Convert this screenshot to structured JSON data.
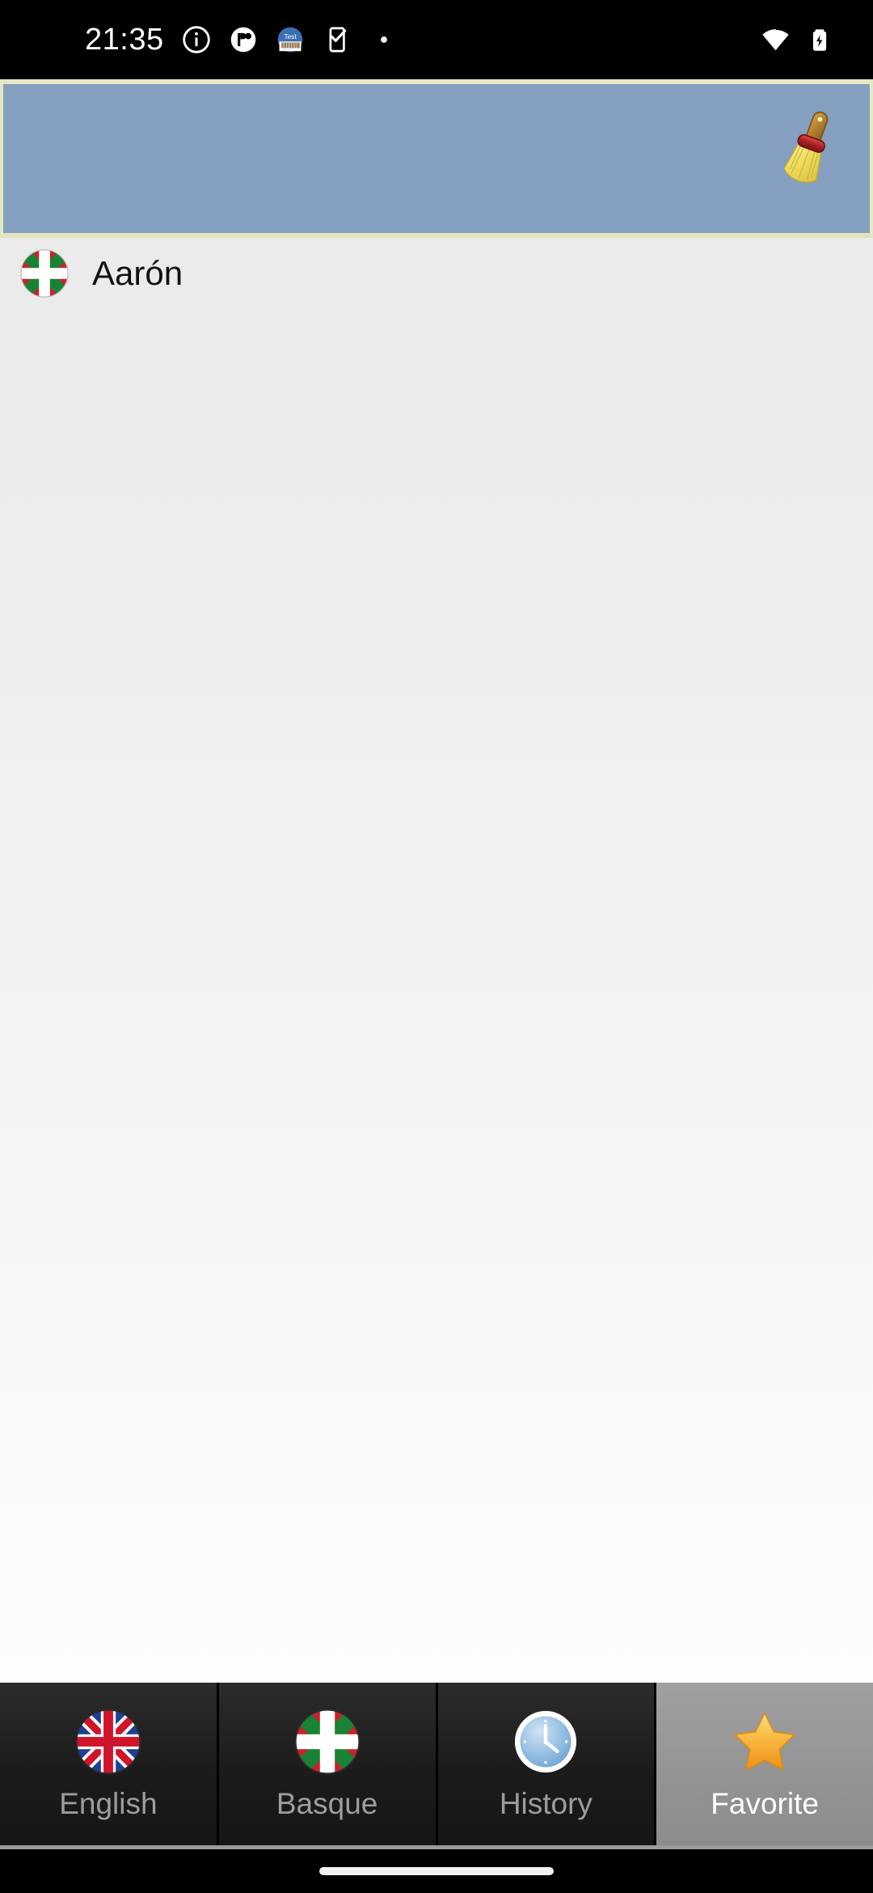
{
  "status_bar": {
    "time": "21:35",
    "left_icons": [
      {
        "name": "info-circle-icon"
      },
      {
        "name": "pie-chart-circle-icon"
      },
      {
        "name": "test-app-icon",
        "label": "Test"
      },
      {
        "name": "checkbox-phone-icon"
      },
      {
        "name": "dot-icon"
      }
    ],
    "right_icons": [
      {
        "name": "wifi-icon"
      },
      {
        "name": "battery-charging-icon"
      }
    ]
  },
  "header": {
    "background_color": "#859fc0",
    "border_color": "#e6e8c2",
    "clear_button": {
      "name": "clear-broom-button",
      "tooltip": "Clear"
    }
  },
  "content": {
    "background_top_color": "#ebebeb",
    "background_bottom_color": "#fdfdfd",
    "items": [
      {
        "flag": "basque-flag-icon",
        "label": "Aarón"
      }
    ]
  },
  "tab_bar": {
    "selected_index": 3,
    "tabs": [
      {
        "label": "English",
        "icon": "uk-flag-icon",
        "selected": false
      },
      {
        "label": "Basque",
        "icon": "basque-flag-icon",
        "selected": false
      },
      {
        "label": "History",
        "icon": "clock-icon",
        "selected": false
      },
      {
        "label": "Favorite",
        "icon": "star-icon",
        "selected": true
      }
    ]
  },
  "colors": {
    "accent_blue": "#859fc0",
    "header_border": "#e6e8c2",
    "tab_selected_bg": "#949494",
    "tab_label_inactive": "#9d9d9d",
    "tab_label_active": "#ffffff",
    "star_gold": "#f5a623"
  }
}
